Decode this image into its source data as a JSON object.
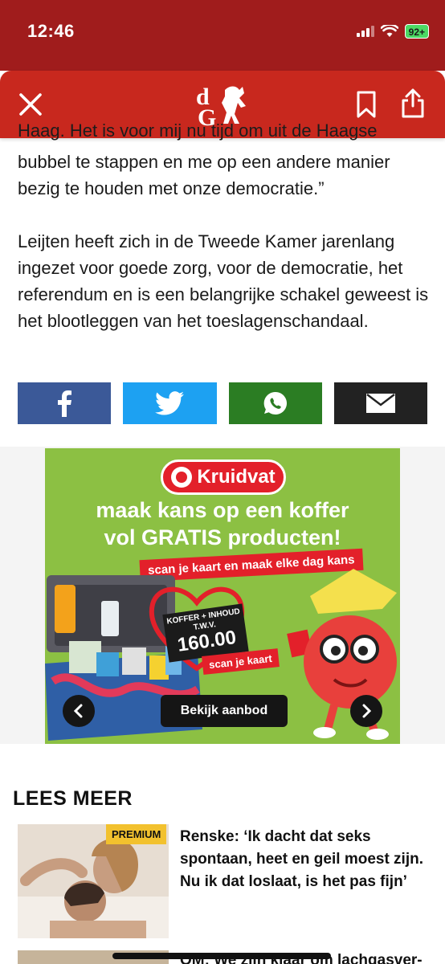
{
  "status_bar": {
    "time": "12:46",
    "battery": "92+"
  },
  "header": {
    "logo_text": "dG"
  },
  "article": {
    "cut_line": "Haag. Het is voor mij nu tijd om uit de Haagse",
    "para1": "bubbel te stappen en me op een andere manier bezig te houden met onze democratie.”",
    "para2": "Leijten heeft zich in de Tweede Kamer jarenlang ingezet voor goede zorg, voor de democratie, het referendum en is een belangrijke schakel geweest is het blootleggen van het toeslagenschandaal."
  },
  "share": {
    "colors": {
      "facebook": "#3b5998",
      "twitter": "#1da1f2",
      "whatsapp": "#2b7d23",
      "mail": "#222222"
    }
  },
  "ad": {
    "brand": "Kruidvat",
    "headline_1": "maak kans op een koffer",
    "headline_2": "vol GRATIS producten!",
    "tagline": "scan je kaart en maak elke dag kans",
    "price_label": "KOFFER + INHOUD T.W.V.",
    "price": "160.00",
    "scan_label": "scan je kaart",
    "cta": "Bekijk aanbod"
  },
  "lees_meer": {
    "title": "LEES MEER",
    "items": [
      {
        "badge": "PREMIUM",
        "title": "Renske: ‘Ik dacht dat seks spontaan, heet en geil moest zijn. Nu ik dat loslaat, is het pas fijn’"
      },
      {
        "title": "OM: We zijn klaar om lachgasver-"
      }
    ]
  }
}
